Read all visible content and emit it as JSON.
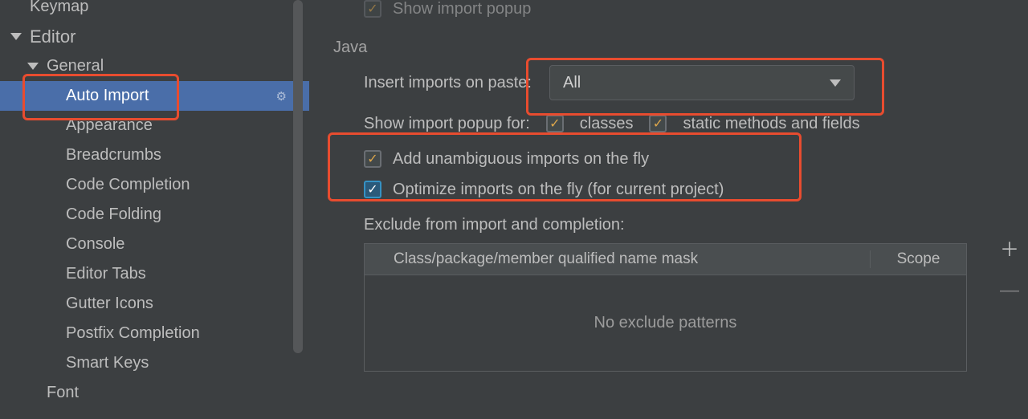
{
  "sidebar": {
    "items": [
      {
        "label": "Keymap",
        "level": 0,
        "expandable": false,
        "selected": false
      },
      {
        "label": "Editor",
        "level": 0,
        "expandable": true,
        "selected": false
      },
      {
        "label": "General",
        "level": 1,
        "expandable": true,
        "selected": false
      },
      {
        "label": "Auto Import",
        "level": 2,
        "expandable": false,
        "selected": true
      },
      {
        "label": "Appearance",
        "level": 2,
        "expandable": false,
        "selected": false
      },
      {
        "label": "Breadcrumbs",
        "level": 2,
        "expandable": false,
        "selected": false
      },
      {
        "label": "Code Completion",
        "level": 2,
        "expandable": false,
        "selected": false
      },
      {
        "label": "Code Folding",
        "level": 2,
        "expandable": false,
        "selected": false
      },
      {
        "label": "Console",
        "level": 2,
        "expandable": false,
        "selected": false
      },
      {
        "label": "Editor Tabs",
        "level": 2,
        "expandable": false,
        "selected": false
      },
      {
        "label": "Gutter Icons",
        "level": 2,
        "expandable": false,
        "selected": false
      },
      {
        "label": "Postfix Completion",
        "level": 2,
        "expandable": false,
        "selected": false
      },
      {
        "label": "Smart Keys",
        "level": 2,
        "expandable": false,
        "selected": false
      },
      {
        "label": "Font",
        "level": 1,
        "expandable": false,
        "selected": false
      }
    ]
  },
  "content": {
    "show_import_popup": "Show import popup",
    "java_section": "Java",
    "insert_imports_label": "Insert imports on paste:",
    "insert_imports_value": "All",
    "show_import_for_label": "Show import popup for:",
    "classes": "classes",
    "static_methods": "static methods and fields",
    "add_unambiguous": "Add unambiguous imports on the fly",
    "optimize_imports": "Optimize imports on the fly (for current project)",
    "exclude_label": "Exclude from import and completion:",
    "col_class": "Class/package/member qualified name mask",
    "col_scope": "Scope",
    "no_patterns": "No exclude patterns"
  }
}
